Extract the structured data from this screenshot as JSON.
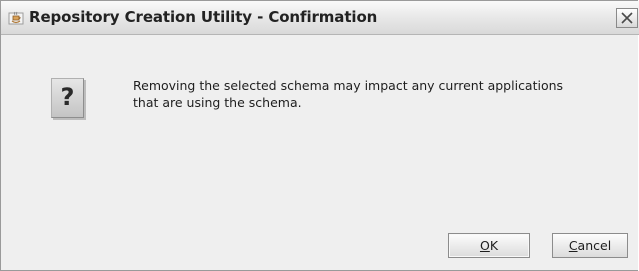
{
  "window": {
    "title": "Repository Creation Utility - Confirmation",
    "app_icon": "java-coffee-cup-icon",
    "close_icon": "close-icon"
  },
  "dialog": {
    "icon": "question-icon",
    "icon_glyph": "?",
    "message_lines": [
      "Removing the selected schema may impact any current applications",
      "that are using the schema."
    ]
  },
  "buttons": {
    "ok": {
      "mnemonic": "O",
      "rest": "K"
    },
    "cancel": {
      "mnemonic": "C",
      "rest": "ancel"
    }
  },
  "colors": {
    "dialog_background": "#efefef",
    "titlebar_top": "#fafafa",
    "titlebar_bottom": "#d9d9d9",
    "text": "#1e1e1e"
  }
}
